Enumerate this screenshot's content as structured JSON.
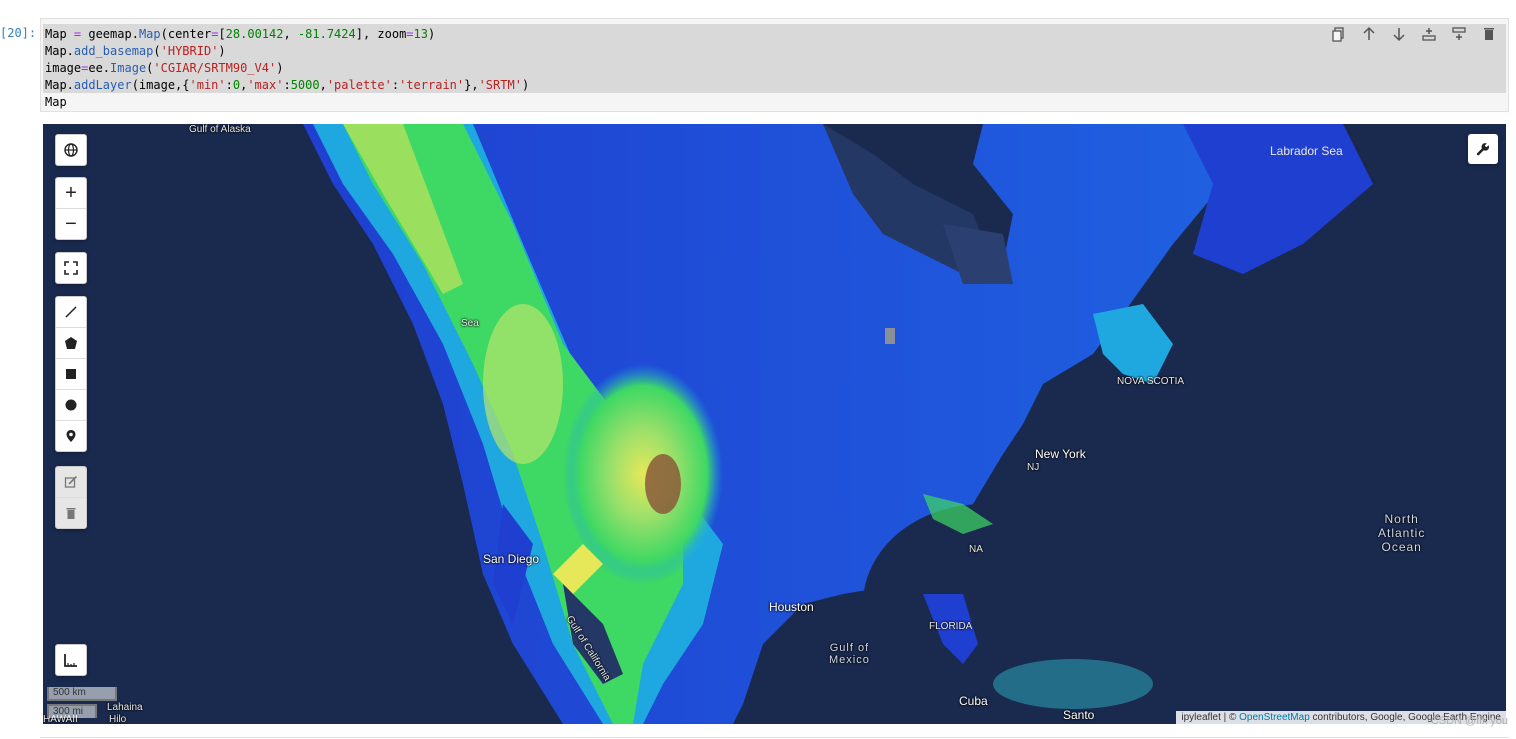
{
  "cell": {
    "prompt": "[20]:",
    "lines": [
      {
        "parts": [
          [
            "Map ",
            ""
          ],
          [
            "= ",
            "op"
          ],
          [
            "geemap.",
            ""
          ],
          [
            "Map",
            "fn"
          ],
          [
            "(center",
            ""
          ],
          [
            "=",
            "op"
          ],
          [
            "[",
            ""
          ],
          [
            "28.00142",
            "num"
          ],
          [
            ", ",
            ""
          ],
          [
            "-81.7424",
            "num"
          ],
          [
            "], zoom",
            ""
          ],
          [
            "=",
            "op"
          ],
          [
            "13",
            "num"
          ],
          [
            ")",
            ""
          ]
        ]
      },
      {
        "parts": [
          [
            "Map.",
            ""
          ],
          [
            "add_basemap",
            "fn"
          ],
          [
            "(",
            ""
          ],
          [
            "'HYBRID'",
            "str"
          ],
          [
            ")",
            ""
          ]
        ]
      },
      {
        "parts": [
          [
            "image",
            ""
          ],
          [
            "=",
            "op"
          ],
          [
            "ee.",
            ""
          ],
          [
            "Image",
            "fn"
          ],
          [
            "(",
            ""
          ],
          [
            "'CGIAR/SRTM90_V4'",
            "str"
          ],
          [
            ")",
            ""
          ]
        ]
      },
      {
        "parts": [
          [
            "Map.",
            ""
          ],
          [
            "addLayer",
            "fn"
          ],
          [
            "(image,{",
            ""
          ],
          [
            "'min'",
            "str"
          ],
          [
            ":",
            ""
          ],
          [
            "0",
            "num"
          ],
          [
            ",",
            ""
          ],
          [
            "'max'",
            "str"
          ],
          [
            ":",
            ""
          ],
          [
            "5000",
            "num"
          ],
          [
            ",",
            ""
          ],
          [
            "'palette'",
            "str"
          ],
          [
            ":",
            ""
          ],
          [
            "'terrain'",
            "str"
          ],
          [
            "},",
            ""
          ],
          [
            "'SRTM'",
            "str"
          ],
          [
            ")",
            ""
          ]
        ]
      },
      {
        "parts": [
          [
            "Map",
            ""
          ]
        ]
      }
    ]
  },
  "toolbar": {
    "items": [
      "duplicate-icon",
      "arrow-up-icon",
      "arrow-down-icon",
      "insert-above-icon",
      "insert-below-icon",
      "trash-icon"
    ]
  },
  "map": {
    "labels": {
      "labrador_sea": "Labrador Sea",
      "gulf_of_alaska": "Gulf of Alaska",
      "new_york": "New York",
      "nj": "NJ",
      "nova_scotia": "NOVA SCOTIA",
      "north_atlantic_ocean": "North\nAtlantic\nOcean",
      "san_diego": "San Diego",
      "gulf_of_california": "Gulf of California",
      "houston": "Houston",
      "gulf_of_mexico": "Gulf of\nMexico",
      "florida": "FLORIDA",
      "santo": "Santo",
      "cuba": "Cuba",
      "hawaii": "HAWAII",
      "lahaina": "Lahaina",
      "hilo": "Hilo",
      "sea": "Sea",
      "na": "NA"
    },
    "scale": {
      "metric": "500 km",
      "imperial": "300 mi"
    },
    "attribution": {
      "prefix": "ipyleaflet | © ",
      "link": "OpenStreetMap",
      "suffix": " contributors, Google, Google Earth Engine"
    },
    "watermark": "CSDN @fix you",
    "colors": {
      "ocean": "#1a2a4f",
      "low": "#1f3fd0",
      "mid": "#1fa8e0",
      "high": "#3ed864",
      "upper": "#e6e85a",
      "peak": "#8a5a3a"
    }
  }
}
